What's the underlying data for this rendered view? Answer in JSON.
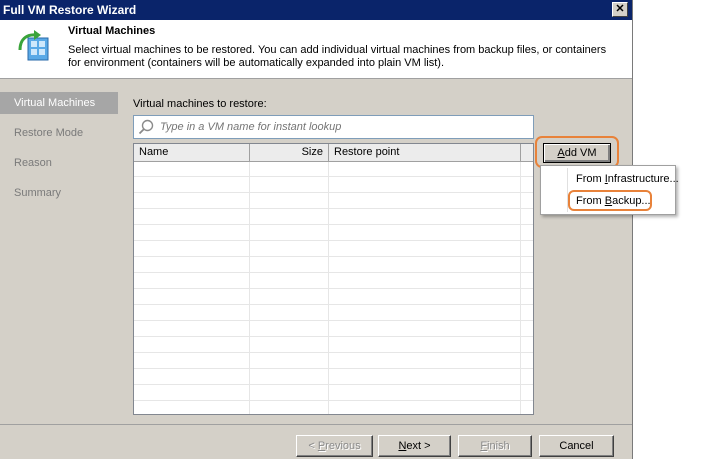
{
  "window": {
    "title": "Full VM Restore Wizard",
    "close_label": "✕"
  },
  "header": {
    "title": "Virtual Machines",
    "description": "Select virtual machines to be restored. You can add individual virtual machines from backup files, or containers for environment (containers will be automatically expanded into plain VM list).",
    "icon": "vm-restore-icon"
  },
  "nav": {
    "items": [
      {
        "label": "Virtual Machines",
        "active": true
      },
      {
        "label": "Restore Mode",
        "active": false
      },
      {
        "label": "Reason",
        "active": false
      },
      {
        "label": "Summary",
        "active": false
      }
    ]
  },
  "main": {
    "section_label": "Virtual machines to restore:",
    "search": {
      "placeholder": "Type in a VM name for instant lookup",
      "value": "",
      "icon": "search-icon"
    },
    "table": {
      "columns": [
        "Name",
        "Size",
        "Restore point"
      ],
      "rows": []
    }
  },
  "add_vm": {
    "label_prefix": "",
    "label_key": "A",
    "label_rest": "dd VM",
    "menu": [
      {
        "prefix": "From ",
        "key": "I",
        "rest": "nfrastructure..."
      },
      {
        "prefix": "From ",
        "key": "B",
        "rest": "ackup..."
      }
    ]
  },
  "footer": {
    "previous": {
      "prefix": "< ",
      "key": "P",
      "rest": "revious",
      "enabled": false
    },
    "next": {
      "prefix": "",
      "key": "N",
      "rest": "ext >",
      "enabled": true
    },
    "finish": {
      "prefix": "",
      "key": "F",
      "rest": "inish",
      "enabled": false
    },
    "cancel": {
      "label": "Cancel",
      "enabled": true
    }
  },
  "colors": {
    "titlebar": "#0a246a",
    "accent_highlight": "#e8823a",
    "nav_active": "#a6a6a6",
    "dialog_bg": "#d4d0c8"
  }
}
